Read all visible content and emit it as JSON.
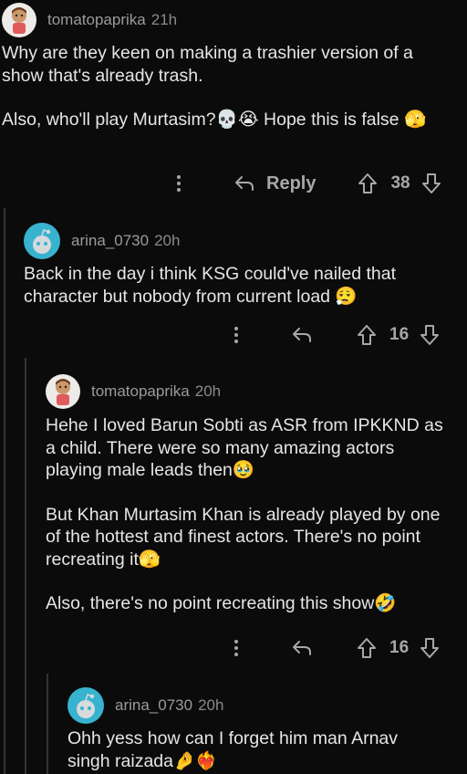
{
  "comments": [
    {
      "username": "tomatopaprika",
      "time": "21h",
      "avatar": "tomato-avatar",
      "body": [
        "Why are they keen on making a trashier version of a show that's already trash.",
        "Also, who'll play Murtasim?💀😭 Hope this is false 🫣"
      ],
      "reply_label": "Reply",
      "votes": "38"
    },
    {
      "username": "arina_0730",
      "time": "20h",
      "avatar": "snoo-avatar",
      "body": [
        "Back in the day i think KSG could've nailed that character but nobody from current load 😮‍💨"
      ],
      "votes": "16"
    },
    {
      "username": "tomatopaprika",
      "time": "20h",
      "avatar": "tomato-avatar",
      "body": [
        "Hehe I loved Barun Sobti as ASR from IPKKND as a child. There were so many amazing actors playing male leads then🥹",
        "But Khan Murtasim Khan is already played by one of the hottest and finest actors. There's no point recreating it🫣",
        "Also, there's no point recreating this show🤣"
      ],
      "votes": "16"
    },
    {
      "username": "arina_0730",
      "time": "20h",
      "avatar": "snoo-avatar",
      "body": [
        "Ohh yess how can I forget him man Arnav singh raizada🤌❤️‍🔥"
      ]
    }
  ],
  "colors": {
    "snoo_bg": "#38b3cf",
    "background": "#0b0b0b",
    "text": "#e6e6e6",
    "meta": "#9b9b9b"
  }
}
